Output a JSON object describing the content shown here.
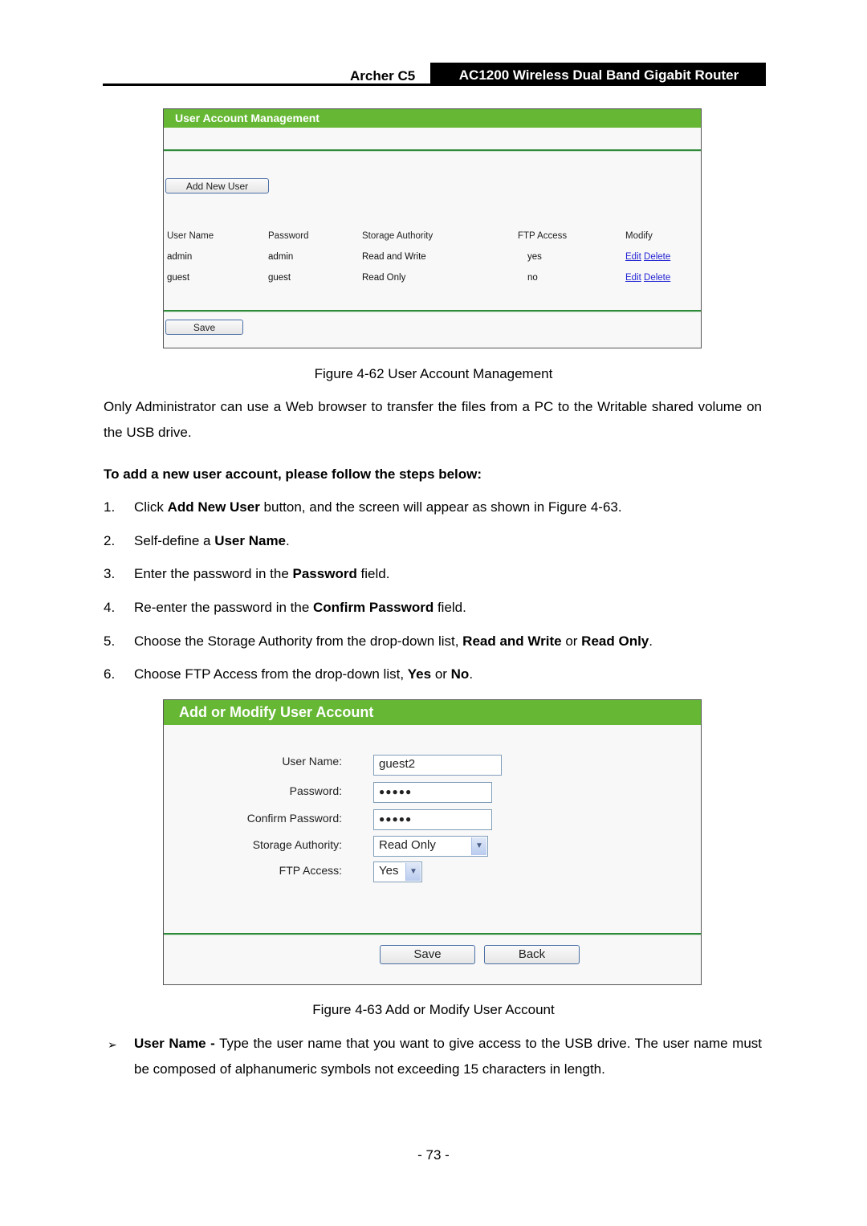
{
  "page_header": {
    "model": "Archer C5",
    "product": "AC1200 Wireless Dual Band Gigabit Router"
  },
  "figure62": {
    "panel_title": "User Account Management",
    "add_new_user_button": "Add New User",
    "table": {
      "headers": [
        "User Name",
        "Password",
        "Storage Authority",
        "FTP Access",
        "Modify"
      ],
      "rows": [
        {
          "user_name": "admin",
          "password": "admin",
          "storage_authority": "Read and Write",
          "ftp_access": "yes",
          "edit": "Edit",
          "delete": "Delete"
        },
        {
          "user_name": "guest",
          "password": "guest",
          "storage_authority": "Read Only",
          "ftp_access": "no",
          "edit": "Edit",
          "delete": "Delete"
        }
      ]
    },
    "save_button": "Save",
    "caption": "Figure 4-62 User Account Management"
  },
  "intro_paragraph": "Only Administrator can use a Web browser to transfer the files from a PC to the Writable shared volume on the USB drive.",
  "steps_heading": "To add a new user account, please follow the steps below:",
  "steps": [
    {
      "num": "1.",
      "pre": "Click ",
      "bold": "Add New User",
      "post": " button, and the screen will appear as shown in Figure 4-63."
    },
    {
      "num": "2.",
      "pre": "Self-define a ",
      "bold": "User Name",
      "post": "."
    },
    {
      "num": "3.",
      "pre": "Enter the password in the ",
      "bold": "Password",
      "post": " field."
    },
    {
      "num": "4.",
      "pre": "Re-enter the password in the ",
      "bold": "Confirm Password",
      "post": " field."
    },
    {
      "num": "5.",
      "pre": "Choose the Storage Authority from the drop-down list, ",
      "bold": "Read and Write",
      "mid": " or ",
      "bold2": "Read Only",
      "post": "."
    },
    {
      "num": "6.",
      "pre": "Choose FTP Access from the drop-down list, ",
      "bold": "Yes",
      "mid": " or ",
      "bold2": "No",
      "post": "."
    }
  ],
  "figure63": {
    "panel_title": "Add or Modify User Account",
    "fields": {
      "user_name": {
        "label": "User Name:",
        "value": "guest2"
      },
      "password": {
        "label": "Password:",
        "value": "●●●●●"
      },
      "confirm_password": {
        "label": "Confirm Password:",
        "value": "●●●●●"
      },
      "storage_authority": {
        "label": "Storage Authority:",
        "value": "Read Only"
      },
      "ftp_access": {
        "label": "FTP Access:",
        "value": "Yes"
      }
    },
    "save_button": "Save",
    "back_button": "Back",
    "caption": "Figure 4-63 Add or Modify User Account"
  },
  "bullets": [
    {
      "icon": "arrow-bullet-icon",
      "glyph": "➢",
      "bold": "User Name -",
      "text": " Type the user name that you want to give access to the USB drive. The user name must be composed of alphanumeric symbols not exceeding 15 characters in length."
    }
  ],
  "page_number": "- 73 -",
  "colors": {
    "panel_header_green": "#66b834",
    "divider_green": "#2e8b3a",
    "link_blue": "#2424d4"
  }
}
